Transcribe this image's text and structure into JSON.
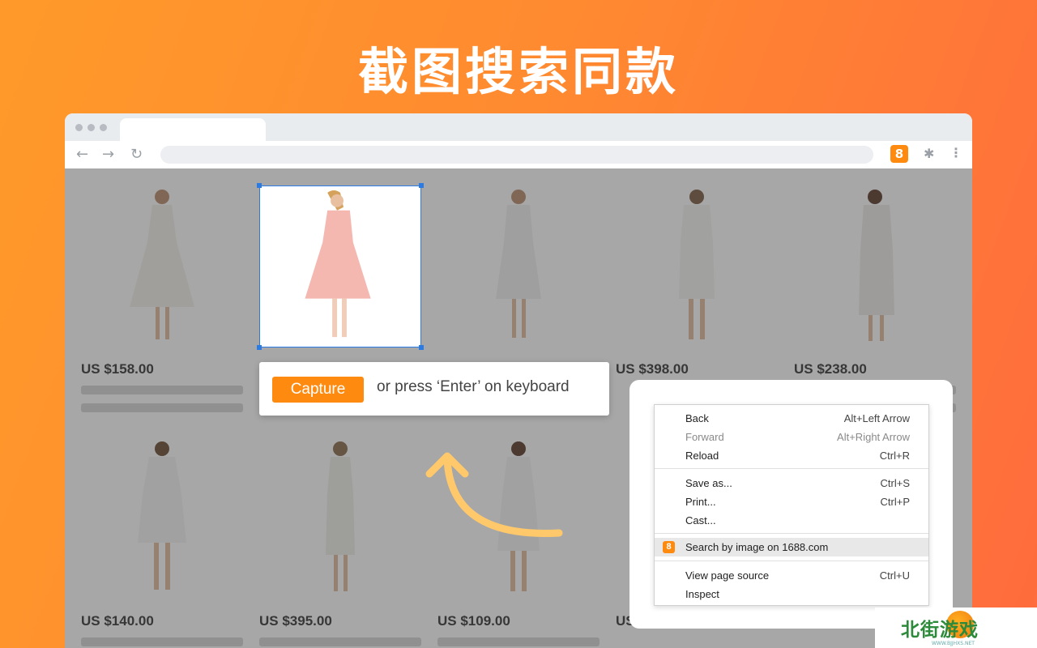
{
  "headline": "截图搜索同款",
  "browser": {
    "extension_badge": "8"
  },
  "products_row1": [
    {
      "price": "US $158.00"
    },
    {
      "price": ""
    },
    {
      "price": ""
    },
    {
      "price": "US $398.00"
    },
    {
      "price": "US $238.00"
    }
  ],
  "products_row2": [
    {
      "price": "US $140.00"
    },
    {
      "price": "US $395.00"
    },
    {
      "price": "US $109.00"
    },
    {
      "price": "US"
    }
  ],
  "capture": {
    "button_label": "Capture",
    "hint": "or press ‘Enter’ on keyboard"
  },
  "context_menu": {
    "back": {
      "label": "Back",
      "shortcut": "Alt+Left Arrow"
    },
    "forward": {
      "label": "Forward",
      "shortcut": "Alt+Right Arrow"
    },
    "reload": {
      "label": "Reload",
      "shortcut": "Ctrl+R"
    },
    "save_as": {
      "label": "Save as...",
      "shortcut": "Ctrl+S"
    },
    "print": {
      "label": "Print...",
      "shortcut": "Ctrl+P"
    },
    "cast": {
      "label": "Cast...",
      "shortcut": ""
    },
    "search_by_image": {
      "label": "Search by image on 1688.com",
      "icon_text": "8"
    },
    "view_source": {
      "label": "View page source",
      "shortcut": "Ctrl+U"
    },
    "inspect": {
      "label": "Inspect",
      "shortcut": ""
    }
  },
  "watermark": {
    "text": "北街游戏",
    "small": "WWW.BJJHXS.NET"
  },
  "colors": {
    "accent": "#ff8a10",
    "selection": "#2a7be4",
    "arrow": "#ffc96b"
  }
}
